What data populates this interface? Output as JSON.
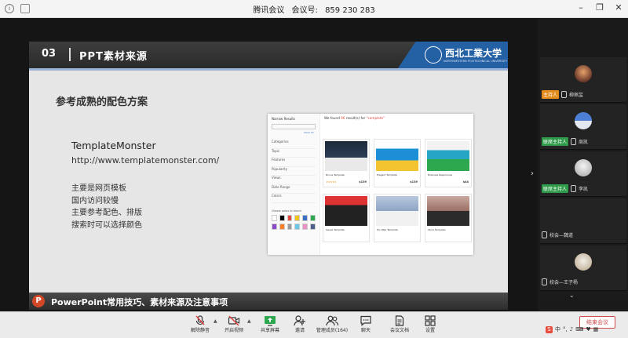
{
  "titlebar": {
    "app": "腾讯会议",
    "meeting_label": "会议号:",
    "meeting_id": "859 230 283"
  },
  "slide": {
    "section_no": "03",
    "section_title": "PPT素材来源",
    "logo_text": "西北工業大学",
    "logo_subtitle": "NORTHWESTERN POLYTECHNICAL UNIVERSITY",
    "heading": "参考成熟的配色方案",
    "site_name": "TemplateMonster",
    "site_url": "http://www.templatemonster.com/",
    "bullets": [
      "主要是网页模板",
      "国内访问较慢",
      "主要参考配色、排版",
      "搜索时可以选择颜色"
    ],
    "footer": "PowerPoint常用技巧、素材来源及注意事项",
    "screenshot": {
      "sidebar_title": "Narrow Results",
      "clear_all": "Clear All",
      "filters": [
        "Categories",
        "Topic",
        "Features",
        "Popularity",
        "Views",
        "Date Range",
        "Colors"
      ],
      "colors_label": "Choose colors to search",
      "found_prefix": "We found",
      "found_count": "96",
      "found_mid": "result(s) for",
      "found_query": "\"complete\"",
      "card_names": [
        "Bonus Template",
        "Elegant Template",
        "Business Responsive",
        "Sweet Template",
        "Pro Web Template",
        "Store Template"
      ],
      "prices": [
        "$139",
        "$139",
        "$44"
      ],
      "colors": [
        "#ffffff",
        "#000000",
        "#e2473c",
        "#f0c419",
        "#3b6fc4",
        "#2ea84f",
        "#8a4cc6",
        "#ff7f2a",
        "#9b9b9b",
        "#6ec6e6",
        "#e891c2",
        "#4b5f8a"
      ]
    }
  },
  "participants": [
    {
      "role": "主持人",
      "role_color": "#e38b1c",
      "name": "柳佩玺"
    },
    {
      "role": "联席主持人",
      "role_color": "#2e9a4a",
      "name": "周凯"
    },
    {
      "role": "联席主持人",
      "role_color": "#2e9a4a",
      "name": "李凯"
    },
    {
      "role": "",
      "role_color": "",
      "name": "校会—魏道"
    },
    {
      "role": "",
      "role_color": "",
      "name": "校会—王子杨"
    }
  ],
  "toolbar": {
    "items": [
      {
        "label": "解除静音",
        "icon": "mic-muted-icon"
      },
      {
        "label": "开启视频",
        "icon": "camera-off-icon"
      },
      {
        "label": "共享屏幕",
        "icon": "screen-share-icon"
      },
      {
        "label": "邀请",
        "icon": "invite-user-icon"
      },
      {
        "label": "管理成员(164)",
        "icon": "members-icon"
      },
      {
        "label": "聊天",
        "icon": "chat-icon"
      },
      {
        "label": "会议文档",
        "icon": "document-icon"
      },
      {
        "label": "设置",
        "icon": "settings-icon"
      }
    ],
    "end_label": "结束会议"
  },
  "ime": {
    "label": "中"
  }
}
